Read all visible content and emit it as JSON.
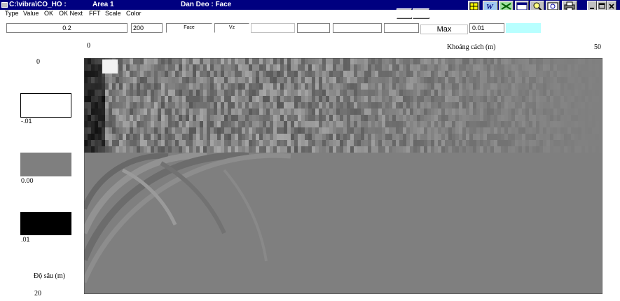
{
  "window": {
    "path": "C:\\vibra\\CO_HO :",
    "area": "Area  1",
    "file": "Dan Deo : Face"
  },
  "menu": [
    "Type",
    "Value",
    "OK",
    "OK Next",
    "FFT",
    "Scale",
    "Color"
  ],
  "toolbar": {
    "value_field": "0.2",
    "fft_field": "200",
    "face_button": "Face",
    "vz_button": "Vz",
    "max_label": "Max",
    "max_field": "0.01",
    "icons": [
      "grid-icon",
      "word-icon",
      "excel-icon",
      "window-icon",
      "magnifier-icon",
      "zoom-icon",
      "printer-icon",
      "minimize-icon",
      "maximize-icon",
      "close-icon",
      "nav-arrows-icon",
      "card-icon"
    ],
    "colors": {
      "cyan_field": "#b8ffff"
    }
  },
  "plot": {
    "x_axis_start": "0",
    "x_axis_title": "Khoảng cách (m)",
    "x_axis_end": "50",
    "y_axis_start": "0",
    "y_axis_title": "Độ sâu (m)",
    "y_axis_end": "20"
  },
  "legend": [
    {
      "label": "-.01",
      "color": "#ffffff"
    },
    {
      "label": "0.00",
      "color": "#7f7f7f"
    },
    {
      "label": ".01",
      "color": "#000000"
    }
  ]
}
